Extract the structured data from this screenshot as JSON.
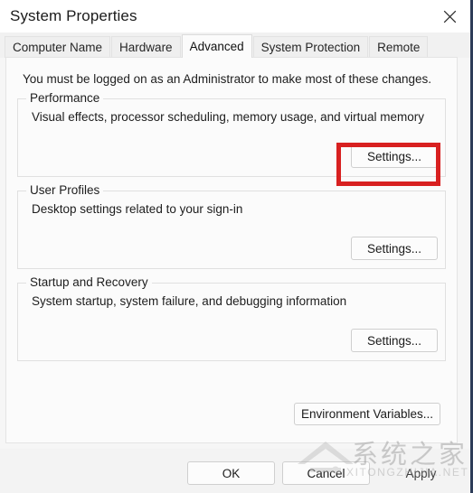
{
  "window": {
    "title": "System Properties",
    "close_icon": "close-icon"
  },
  "tabs": [
    {
      "label": "Computer Name",
      "selected": false
    },
    {
      "label": "Hardware",
      "selected": false
    },
    {
      "label": "Advanced",
      "selected": true
    },
    {
      "label": "System Protection",
      "selected": false
    },
    {
      "label": "Remote",
      "selected": false
    }
  ],
  "content": {
    "admin_note": "You must be logged on as an Administrator to make most of these changes.",
    "groups": [
      {
        "legend": "Performance",
        "description": "Visual effects, processor scheduling, memory usage, and virtual memory",
        "button_label": "Settings...",
        "highlighted": true
      },
      {
        "legend": "User Profiles",
        "description": "Desktop settings related to your sign-in",
        "button_label": "Settings...",
        "highlighted": false
      },
      {
        "legend": "Startup and Recovery",
        "description": "System startup, system failure, and debugging information",
        "button_label": "Settings...",
        "highlighted": false
      }
    ],
    "env_vars_label": "Environment Variables..."
  },
  "footer": {
    "ok_label": "OK",
    "cancel_label": "Cancel",
    "apply_label": "Apply"
  },
  "watermark": {
    "cn": "系统之家",
    "en": "XITONGZHIJIA.NET"
  },
  "colors": {
    "highlight_red": "#d82020",
    "window_background": "#f6f6f6",
    "panel_background": "#fbfbfb",
    "text": "#1d1d1d",
    "window_edge": "#2d3c58"
  }
}
